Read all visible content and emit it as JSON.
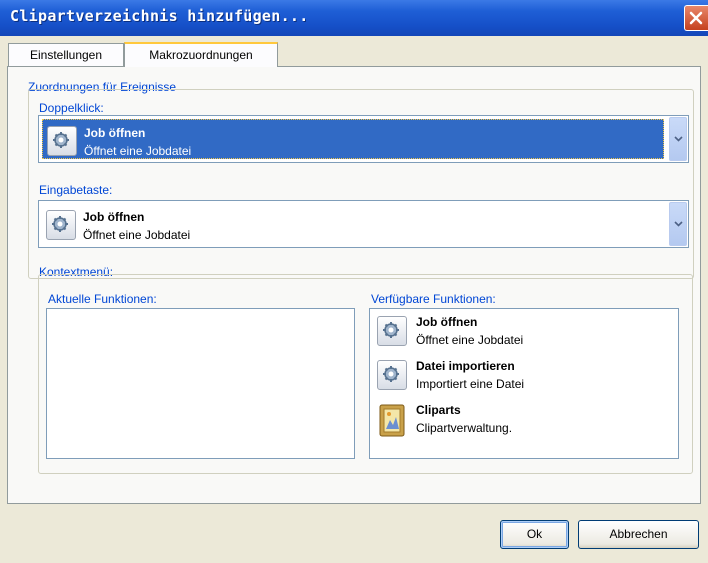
{
  "window": {
    "title": "Clipartverzeichnis hinzufügen...",
    "close_icon": "close-icon"
  },
  "tabs": [
    {
      "label": "Einstellungen",
      "active": false
    },
    {
      "label": "Makrozuordnungen",
      "active": true
    }
  ],
  "events_group": {
    "title": "Zuordnungen für Ereignisse",
    "doubleclick": {
      "label": "Doppelklick:",
      "selected": {
        "name": "Job öffnen",
        "description": "Öffnet eine Jobdatei",
        "icon": "gear-icon"
      }
    },
    "enter": {
      "label": "Eingabetaste:",
      "selected": {
        "name": "Job öffnen",
        "description": "Öffnet eine Jobdatei",
        "icon": "gear-icon"
      }
    }
  },
  "context_menu": {
    "title": "Kontextmenü:",
    "current": {
      "label": "Aktuelle Funktionen:",
      "items": []
    },
    "available": {
      "label": "Verfügbare Funktionen:",
      "items": [
        {
          "name": "Job öffnen",
          "description": "Öffnet eine Jobdatei",
          "icon": "gear-icon"
        },
        {
          "name": "Datei importieren",
          "description": "Importiert eine Datei",
          "icon": "gear-icon"
        },
        {
          "name": "Cliparts",
          "description": "Clipartverwaltung.",
          "icon": "picture-frame-icon"
        }
      ]
    }
  },
  "footer": {
    "ok_label": "Ok",
    "cancel_label": "Abbrechen"
  },
  "colors": {
    "title_bar": "#1650c9",
    "selection": "#316ac5",
    "group_label": "#0046d5"
  }
}
